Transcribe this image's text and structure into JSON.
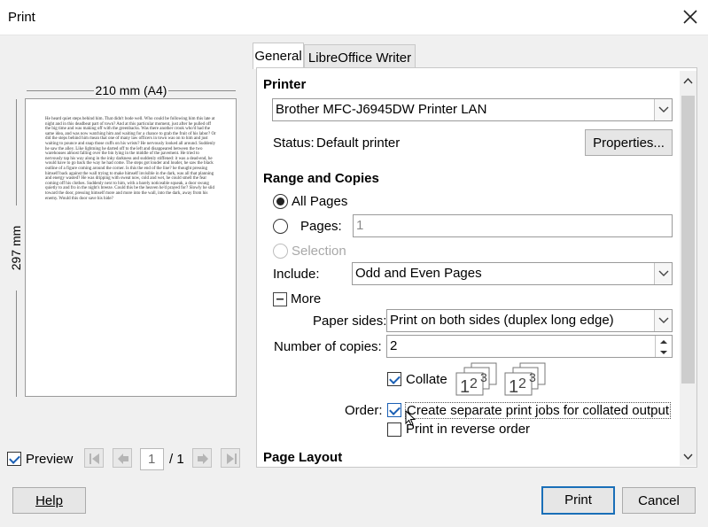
{
  "window": {
    "title": "Print"
  },
  "preview": {
    "width_label": "210 mm (A4)",
    "height_label": "297 mm",
    "page_text": "He heard quiet steps behind him. That didn't bode well. Who could be following him this late at night and in this deadbeat part of town? And at this particular moment, just after he pulled off the big time and was making off with the greenbacks. Was there another crook who'd had the same idea, and was now watching him and waiting for a chance to grab the fruit of his labor? Or did the steps behind him mean that one of many law officers in town was on to him and just waiting to pounce and snap those cuffs on his wrists? He nervously looked all around. Suddenly he saw the alley. Like lightning he darted off to the left and disappeared between the two warehouses almost falling over the bin lying in the middle of the pavement. He tried to nervously tap his way along in the inky darkness and suddenly stiffened: it was a dead-end, he would have to go back the way he had come. The steps got louder and louder, he saw the black outline of a figure coming around the corner. Is this the end of the line? he thought pressing himself back against the wall trying to make himself invisible in the dark, was all that planning and energy wasted? He was dripping with sweat now, cold and wet, he could smell the fear coming off his clothes. Suddenly next to him, with a barely noticeable squeak, a door swung quietly to and fro in the night's breeze. Could this be the heaven he'd prayed for? Slowly he slid toward the door, pressing himself more and more into the wall, into the dark, away from his enemy. Would this door save his hide?",
    "checkbox_label": "Preview",
    "checkbox_checked": true,
    "page_current": "1",
    "page_total": "/ 1"
  },
  "tabs": [
    {
      "label": "General",
      "active": true
    },
    {
      "label": "LibreOffice Writer",
      "active": false
    }
  ],
  "printer": {
    "heading": "Printer",
    "selected": "Brother MFC-J6945DW Printer LAN",
    "status_label": "Status:",
    "status_value": "Default printer",
    "properties_button": "Properties..."
  },
  "range": {
    "heading": "Range and Copies",
    "all_pages": "All Pages",
    "pages_label": "Pages:",
    "pages_value": "1",
    "selection": "Selection",
    "include_label": "Include:",
    "include_value": "Odd and Even Pages",
    "more_label": "More",
    "paper_sides_label": "Paper sides:",
    "paper_sides_value": "Print on both sides (duplex long edge)",
    "copies_label": "Number of copies:",
    "copies_value": "2",
    "collate_label": "Collate",
    "collate_checked": true,
    "order_label": "Order:",
    "separate_jobs_label": "Create separate print jobs for collated output",
    "separate_jobs_checked": true,
    "reverse_label": "Print in reverse order",
    "reverse_checked": false
  },
  "page_layout": {
    "heading": "Page Layout"
  },
  "buttons": {
    "help": "Help",
    "print": "Print",
    "cancel": "Cancel"
  },
  "colors": {
    "accent": "#1a6fb8",
    "panel_bg": "#ffffff",
    "dialog_bg": "#f0f0f0"
  }
}
